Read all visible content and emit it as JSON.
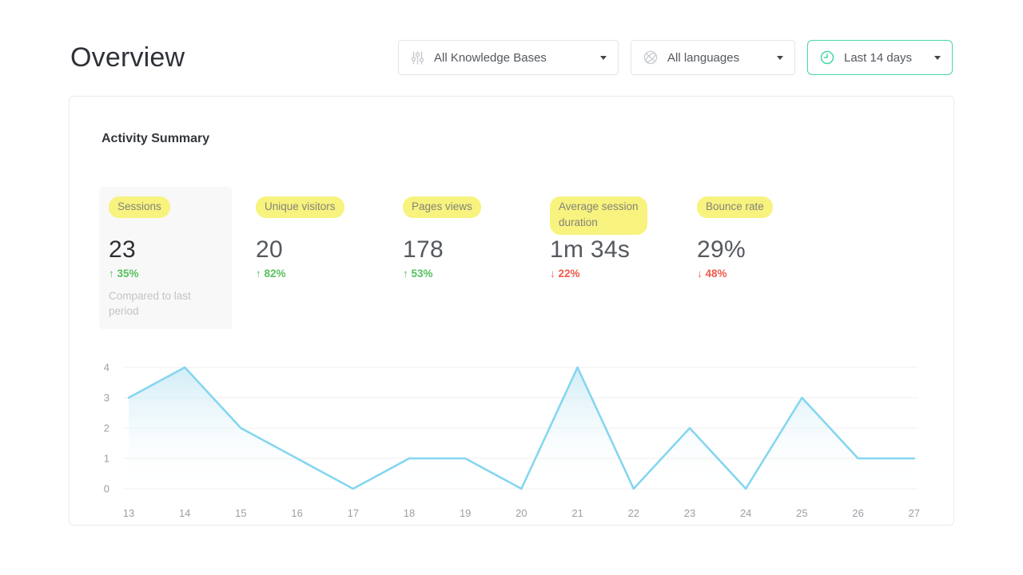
{
  "page_title": "Overview",
  "filters": {
    "knowledge_base": {
      "label": "All Knowledge Bases",
      "icon": "sliders-icon"
    },
    "language": {
      "label": "All languages",
      "icon": "globe-icon"
    },
    "date_range": {
      "label": "Last 14 days",
      "icon": "clock-icon"
    }
  },
  "card": {
    "title": "Activity Summary"
  },
  "metrics": [
    {
      "id": "sessions",
      "label": "Sessions",
      "value": "23",
      "delta": "35%",
      "direction": "up",
      "caption": "Compared to last period",
      "selected": true
    },
    {
      "id": "unique-visitors",
      "label": "Unique visitors",
      "value": "20",
      "delta": "82%",
      "direction": "up"
    },
    {
      "id": "pages-views",
      "label": "Pages views",
      "value": "178",
      "delta": "53%",
      "direction": "up"
    },
    {
      "id": "average-session-duration",
      "label": "Average session duration",
      "value": "1m 34s",
      "delta": "22%",
      "direction": "down"
    },
    {
      "id": "bounce-rate",
      "label": "Bounce rate",
      "value": "29%",
      "delta": "48%",
      "direction": "down"
    }
  ],
  "colors": {
    "accent_green": "#56c15e",
    "accent_red": "#ee5a4a",
    "accent_teal": "#47d7a8",
    "highlight_yellow": "#f7f37e",
    "chart_line": "#85d6f0",
    "chart_fill_top": "#c9e9f5",
    "grid_line": "#efefef"
  },
  "chart_data": {
    "type": "area",
    "title": "",
    "x": [
      13,
      14,
      15,
      16,
      17,
      18,
      19,
      20,
      21,
      22,
      23,
      24,
      25,
      26,
      27
    ],
    "series": [
      {
        "name": "Sessions",
        "values": [
          3,
          4,
          2,
          1,
          0,
          1,
          1,
          0,
          4,
          0,
          2,
          0,
          3,
          1,
          1
        ]
      }
    ],
    "xlabel": "",
    "ylabel": "",
    "ylim": [
      0,
      4
    ],
    "yticks": [
      0,
      1,
      2,
      3,
      4
    ],
    "grid": "horizontal-only",
    "legend": "none"
  }
}
